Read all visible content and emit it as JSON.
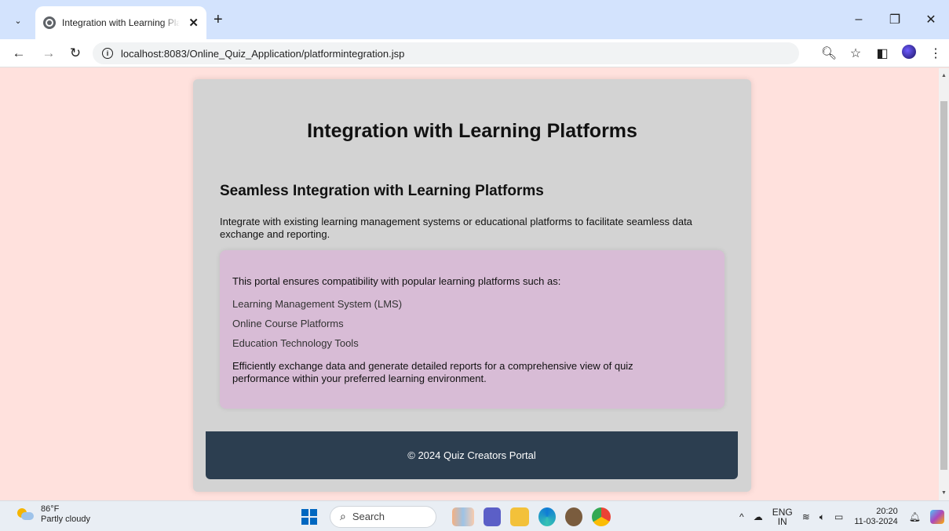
{
  "browser": {
    "tab_title": "Integration with Learning Platforms",
    "tab_close_glyph": "✕",
    "new_tab_glyph": "+",
    "url": "localhost:8083/Online_Quiz_Application/platformintegration.jsp",
    "icons": [
      "tab-dropdown-icon",
      "back-icon",
      "forward-icon",
      "reload-icon",
      "site-info-icon",
      "zoom-icon",
      "bookmark-star-icon",
      "side-panel-icon",
      "profile-avatar",
      "menu-kebab-icon"
    ]
  },
  "page": {
    "title": "Integration with Learning Platforms",
    "section_title": "Seamless Integration with Learning Platforms",
    "section_desc": "Integrate with existing learning management systems or educational platforms to facilitate seamless data exchange and reporting.",
    "box_intro": "This portal ensures compatibility with popular learning platforms such as:",
    "platforms": [
      "Learning Management System (LMS)",
      "Online Course Platforms",
      "Education Technology Tools"
    ],
    "box_outro": "Efficiently exchange data and generate detailed reports for a comprehensive view of quiz performance within your preferred learning environment.",
    "footer": "© 2024 Quiz Creators Portal"
  },
  "colors": {
    "page_bg": "#ffe1dd",
    "container_bg": "#d3d3d3",
    "box_bg": "#d8bcd6",
    "footer_bg": "#2c3e50"
  },
  "taskbar": {
    "temp": "86°F",
    "weather": "Partly cloudy",
    "search_placeholder": "Search",
    "lang_top": "ENG",
    "lang_bottom": "IN",
    "time": "20:20",
    "date": "11-03-2024"
  }
}
